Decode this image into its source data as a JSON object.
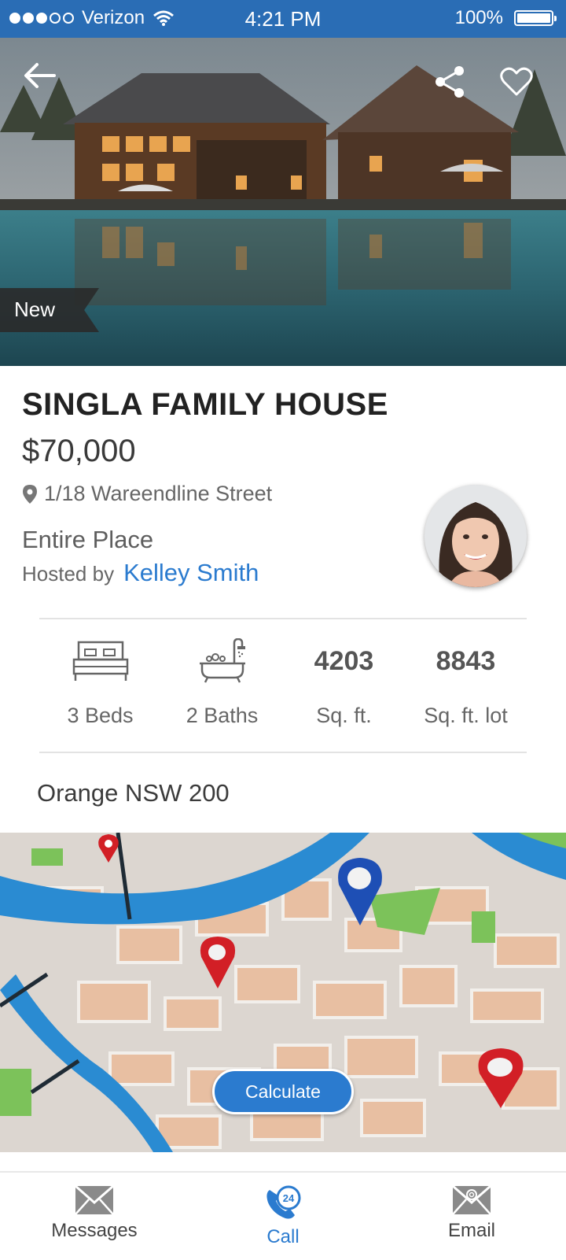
{
  "status_bar": {
    "carrier": "Verizon",
    "time": "4:21 PM",
    "battery": "100%",
    "battery_level": 1.0,
    "signal_bars_filled": 3,
    "signal_bars_total": 5
  },
  "hero": {
    "badge": "New",
    "icons": [
      "back-arrow-icon",
      "share-icon",
      "heart-icon"
    ]
  },
  "listing": {
    "title": "SINGLA FAMILY HOUSE",
    "price": "$70,000",
    "address": "1/18 Wareendline Street",
    "place_type": "Entire Place",
    "hosted_by_label": "Hosted by",
    "host_name": "Kelley Smith"
  },
  "features": [
    {
      "icon": "bed-icon",
      "label": "3 Beds"
    },
    {
      "icon": "bathtub-icon",
      "label": "2 Baths"
    },
    {
      "value": "4203",
      "label": "Sq. ft."
    },
    {
      "value": "8843",
      "label": "Sq. ft. lot"
    }
  ],
  "region": "Orange NSW 200",
  "map": {
    "calculate_label": "Calculate"
  },
  "bottom_nav": [
    {
      "icon": "envelope-icon",
      "label": "Messages"
    },
    {
      "icon": "phone-24-icon",
      "label": "Call",
      "badge": "24",
      "active": true
    },
    {
      "icon": "email-at-icon",
      "label": "Email"
    }
  ],
  "colors": {
    "accent": "#2b7bcf",
    "status_bar": "#2a6db5",
    "text_dark": "#222222"
  }
}
